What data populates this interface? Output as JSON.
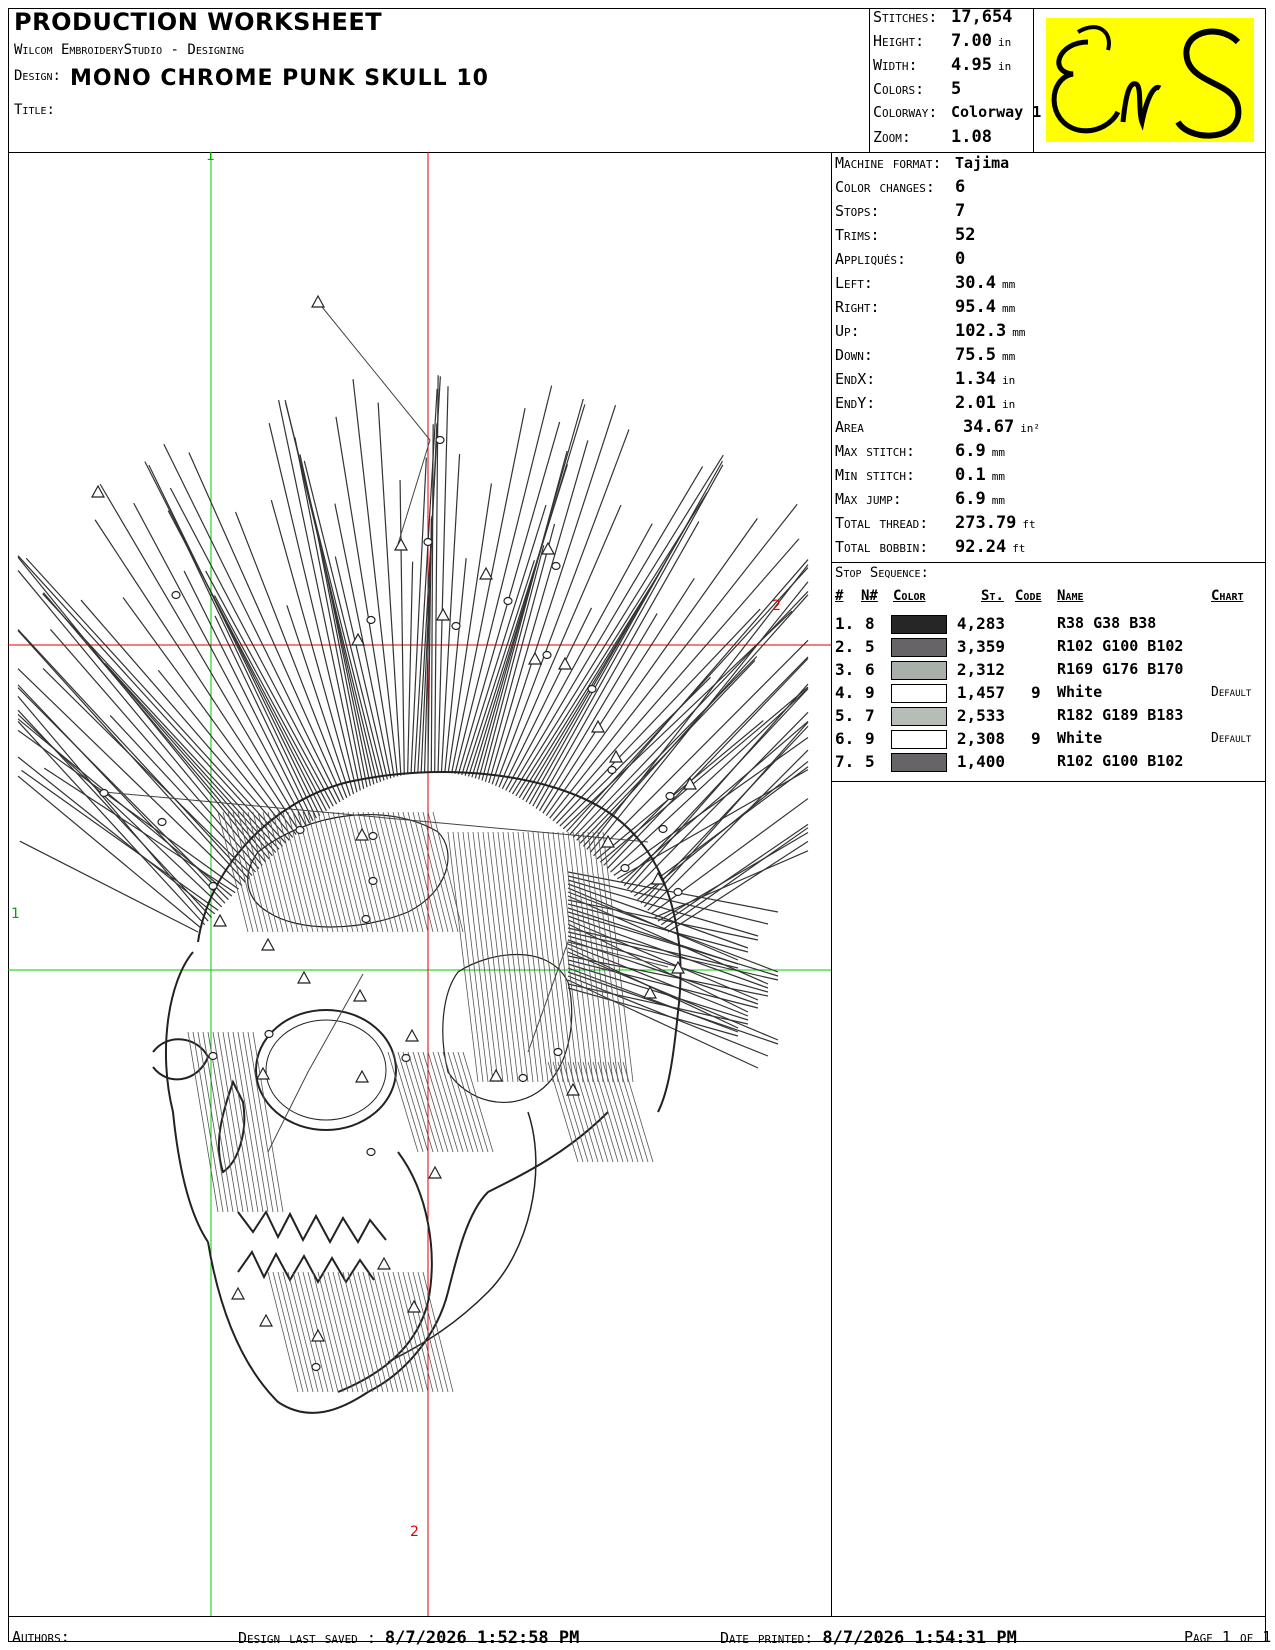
{
  "header": {
    "title": "PRODUCTION WORKSHEET",
    "software": "Wilcom EmbroideryStudio - Designing",
    "design_label": "Design:",
    "design_name": "MONO CHROME PUNK SKULL  10",
    "title_label": "Title:"
  },
  "summary": [
    {
      "label": "Stitches:",
      "value": "17,654",
      "unit": ""
    },
    {
      "label": "Height:",
      "value": "7.00",
      "unit": "in"
    },
    {
      "label": "Width:",
      "value": "4.95",
      "unit": "in"
    },
    {
      "label": "Colors:",
      "value": "5",
      "unit": ""
    },
    {
      "label": "Colorway:",
      "value": "Colorway 1",
      "unit": ""
    },
    {
      "label": "Zoom:",
      "value": "1.08",
      "unit": ""
    }
  ],
  "logo": {
    "text": "EnS",
    "bg_color": "#ffff00"
  },
  "details": [
    {
      "label": "Machine format:",
      "value": "Tajima",
      "unit": ""
    },
    {
      "label": "Color changes:",
      "value": "6",
      "unit": ""
    },
    {
      "label": "Stops:",
      "value": "7",
      "unit": ""
    },
    {
      "label": "Trims:",
      "value": "52",
      "unit": ""
    },
    {
      "label": "Appliqués:",
      "value": "0",
      "unit": ""
    },
    {
      "label": "Left:",
      "value": "30.4",
      "unit": "mm"
    },
    {
      "label": "Right:",
      "value": "95.4",
      "unit": "mm"
    },
    {
      "label": "Up:",
      "value": "102.3",
      "unit": "mm"
    },
    {
      "label": "Down:",
      "value": "75.5",
      "unit": "mm"
    },
    {
      "label": "EndX:",
      "value": "1.34",
      "unit": "in"
    },
    {
      "label": "EndY:",
      "value": "2.01",
      "unit": "in"
    },
    {
      "label": "Area",
      "value": "34.67",
      "unit": "in²"
    },
    {
      "label": "Max stitch:",
      "value": "6.9",
      "unit": "mm"
    },
    {
      "label": "Min stitch:",
      "value": "0.1",
      "unit": "mm"
    },
    {
      "label": "Max jump:",
      "value": "6.9",
      "unit": "mm"
    },
    {
      "label": "Total thread:",
      "value": "273.79",
      "unit": "ft"
    },
    {
      "label": "Total bobbin:",
      "value": "92.24",
      "unit": "ft"
    }
  ],
  "stop_sequence": {
    "title": "Stop Sequence:",
    "headers": [
      "#",
      "N#",
      "Color",
      "St.",
      "Code",
      "Name",
      "Chart"
    ],
    "rows": [
      {
        "num": "1.",
        "n": "8",
        "color": "#262626",
        "stitches": "4,283",
        "code": "",
        "name": "R38 G38 B38",
        "chart": ""
      },
      {
        "num": "2.",
        "n": "5",
        "color": "#666466",
        "stitches": "3,359",
        "code": "",
        "name": "R102 G100 B102",
        "chart": ""
      },
      {
        "num": "3.",
        "n": "6",
        "color": "#a9b0aa",
        "stitches": "2,312",
        "code": "",
        "name": "R169 G176 B170",
        "chart": ""
      },
      {
        "num": "4.",
        "n": "9",
        "color": "#ffffff",
        "stitches": "1,457",
        "code": "9",
        "name": "White",
        "chart": "Default"
      },
      {
        "num": "5.",
        "n": "7",
        "color": "#b6bdb7",
        "stitches": "2,533",
        "code": "",
        "name": "R182 G189 B183",
        "chart": ""
      },
      {
        "num": "6.",
        "n": "9",
        "color": "#ffffff",
        "stitches": "2,308",
        "code": "9",
        "name": "White",
        "chart": "Default"
      },
      {
        "num": "7.",
        "n": "5",
        "color": "#666466",
        "stitches": "1,400",
        "code": "",
        "name": "R102 G100 B102",
        "chart": ""
      }
    ]
  },
  "guides": {
    "green": "1",
    "red": "2"
  },
  "footer": {
    "authors_label": "Authors:",
    "saved_label": "Design last saved :",
    "saved_value": "8/7/2026 1:52:58 PM",
    "printed_label": "Date printed:",
    "printed_value": "8/7/2026 1:54:31 PM",
    "page_text": "Page 1 of 1"
  }
}
